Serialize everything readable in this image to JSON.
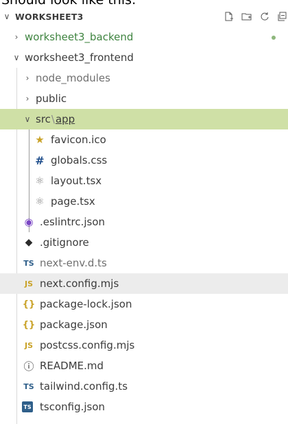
{
  "caption": "Should look like this:",
  "explorer": {
    "root": {
      "chevron": "chevron-down",
      "title": "WORKSHEET3"
    },
    "actions": [
      {
        "icon": "new-file-icon"
      },
      {
        "icon": "new-folder-icon"
      },
      {
        "icon": "refresh-icon"
      },
      {
        "icon": "collapse-all-icon"
      }
    ],
    "items": [
      {
        "label": "worksheet3_backend",
        "type": "folder",
        "expanded": false,
        "status": "modified-dot",
        "color": "#3f8440"
      },
      {
        "label": "worksheet3_frontend",
        "type": "folder",
        "expanded": true
      },
      {
        "label": "node_modules",
        "type": "folder",
        "expanded": false,
        "dimmed": true
      },
      {
        "label": "public",
        "type": "folder",
        "expanded": false
      },
      {
        "label_parts": [
          "src",
          "\\",
          "app"
        ],
        "type": "folder",
        "expanded": true,
        "selected": true
      },
      {
        "label": "favicon.ico",
        "icon": "star-icon",
        "icon_glyph": "★",
        "icon_color": "#c9a227"
      },
      {
        "label": "globals.css",
        "icon": "hash-icon",
        "icon_glyph": "#",
        "icon_color": "#1f4e8c"
      },
      {
        "label": "layout.tsx",
        "icon": "react-icon",
        "icon_glyph": "⚛",
        "icon_color": "#8a8a8a"
      },
      {
        "label": "page.tsx",
        "icon": "react-icon",
        "icon_glyph": "⚛",
        "icon_color": "#8a8a8a"
      },
      {
        "label": ".eslintrc.json",
        "icon": "eslint-icon",
        "icon_glyph": "◉",
        "icon_color": "#7a45c4"
      },
      {
        "label": ".gitignore",
        "icon": "git-icon",
        "icon_glyph": "◆",
        "icon_color": "#2b2b2b"
      },
      {
        "label": "next-env.d.ts",
        "icon": "typescript-icon",
        "icon_glyph": "TS",
        "icon_color": "#2f5f8a",
        "dimmed": true
      },
      {
        "label": "next.config.mjs",
        "icon": "javascript-icon",
        "icon_glyph": "JS",
        "icon_color": "#c9a227",
        "hover": true
      },
      {
        "label": "package-lock.json",
        "icon": "json-icon",
        "icon_glyph": "{}",
        "icon_color": "#c9a227"
      },
      {
        "label": "package.json",
        "icon": "json-icon",
        "icon_glyph": "{}",
        "icon_color": "#c9a227"
      },
      {
        "label": "postcss.config.mjs",
        "icon": "javascript-icon",
        "icon_glyph": "JS",
        "icon_color": "#c9a227"
      },
      {
        "label": "README.md",
        "icon": "info-icon",
        "icon_glyph": "ⓘ",
        "icon_color": "#2b2b2b"
      },
      {
        "label": "tailwind.config.ts",
        "icon": "typescript-icon",
        "icon_glyph": "TS",
        "icon_color": "#2f5f8a"
      },
      {
        "label": "tsconfig.json",
        "icon": "tsconfig-icon",
        "icon_glyph": "TS",
        "icon_color": "#ffffff"
      }
    ]
  }
}
